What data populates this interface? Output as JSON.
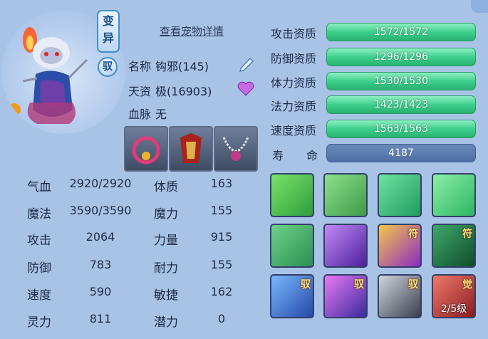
{
  "badges": {
    "variant": "变异",
    "ride": "驭"
  },
  "detail_link": "查看宠物详情",
  "info": {
    "name_label": "名称",
    "name_value": "钩邪(145)",
    "talent_label": "天资",
    "talent_value": "极(16903)",
    "bloodline_label": "血脉",
    "bloodline_value": "无"
  },
  "equipment": [
    "collar-equipment-icon",
    "armor-equipment-icon",
    "necklace-equipment-icon"
  ],
  "stats": [
    {
      "label": "气血",
      "value": "2920/2920",
      "label2": "体质",
      "value2": "163"
    },
    {
      "label": "魔法",
      "value": "3590/3590",
      "label2": "魔力",
      "value2": "155"
    },
    {
      "label": "攻击",
      "value": "2064",
      "label2": "力量",
      "value2": "915"
    },
    {
      "label": "防御",
      "value": "783",
      "label2": "耐力",
      "value2": "155"
    },
    {
      "label": "速度",
      "value": "590",
      "label2": "敏捷",
      "value2": "162"
    },
    {
      "label": "灵力",
      "value": "811",
      "label2": "潜力",
      "value2": "0"
    }
  ],
  "aptitudes": [
    {
      "label": "攻击资质",
      "value": "1572/1572"
    },
    {
      "label": "防御资质",
      "value": "1296/1296"
    },
    {
      "label": "体力资质",
      "value": "1530/1530"
    },
    {
      "label": "法力资质",
      "value": "1423/1423"
    },
    {
      "label": "速度资质",
      "value": "1563/1563"
    }
  ],
  "lifespan": {
    "label": "寿　　命",
    "value": "4187"
  },
  "skills": [
    {
      "icon": "flaming-sword-skill-icon",
      "tag": "",
      "level": ""
    },
    {
      "icon": "boot-skill-icon",
      "tag": "",
      "level": ""
    },
    {
      "icon": "green-light-skill-icon",
      "tag": "",
      "level": ""
    },
    {
      "icon": "heart-frame-skill-icon",
      "tag": "",
      "level": ""
    },
    {
      "icon": "shield-swirl-skill-icon",
      "tag": "",
      "level": ""
    },
    {
      "icon": "purple-burst-skill-icon",
      "tag": "",
      "level": ""
    },
    {
      "icon": "golden-blade-skill-icon",
      "tag": "符",
      "level": ""
    },
    {
      "icon": "green-horse-skill-icon",
      "tag": "符",
      "level": ""
    },
    {
      "icon": "blue-shield-skill-icon",
      "tag": "驭",
      "level": ""
    },
    {
      "icon": "purple-flame-skill-icon",
      "tag": "驭",
      "level": ""
    },
    {
      "icon": "gray-claw-skill-icon",
      "tag": "驭",
      "level": ""
    },
    {
      "icon": "red-awaken-skill-icon",
      "tag": "觉",
      "level": "2/5级"
    }
  ]
}
